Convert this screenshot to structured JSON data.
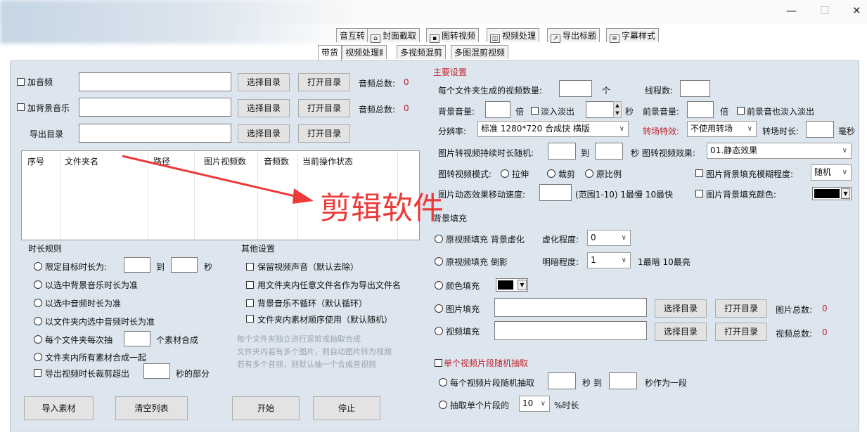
{
  "window": {
    "minimize": "—",
    "maximize": "☐",
    "close": "✕"
  },
  "tabs_row1": [
    {
      "label": "音互转",
      "icon": "audio-convert-icon"
    },
    {
      "label": "封面截取",
      "icon": "image-icon"
    },
    {
      "label": "图转视频",
      "icon": "picture-icon"
    },
    {
      "label": "视频处理",
      "icon": "film-icon"
    },
    {
      "label": "导出标题",
      "icon": "export-icon"
    },
    {
      "label": "字幕样式",
      "icon": "list-icon"
    }
  ],
  "tabs_row2": [
    {
      "label": "带货"
    },
    {
      "label": "视频处理Ⅱ"
    },
    {
      "label": "多视频混剪"
    },
    {
      "label": "多图混剪视频"
    }
  ],
  "left": {
    "add_audio": {
      "label": "加音频",
      "choose": "选择目录",
      "open": "打开目录",
      "count_label": "音频总数:",
      "count": "0"
    },
    "add_bgm": {
      "label": "加背景音乐",
      "choose": "选择目录",
      "open": "打开目录",
      "count_label": "音频总数:",
      "count": "0"
    },
    "export_dir": {
      "label": "导出目录",
      "choose": "选择目录",
      "open": "打开目录"
    },
    "table_headers": [
      "序号",
      "文件夹名",
      "路径",
      "图片视频数",
      "音频数",
      "当前操作状态"
    ],
    "duration_rules": {
      "title": "时长规则",
      "limit": "限定目标时长为:",
      "to": "到",
      "sec": "秒",
      "by_bgm": "以选中背景音乐时长为准",
      "by_audio": "以选中音频时长为准",
      "by_folder_audio": "以文件夹内选中音频时长为准",
      "per_folder": "每个文件夹每次抽",
      "per_folder_suffix": "个素材合成",
      "all_in_folder": "文件夹内所有素材合成一起",
      "trim_over": "导出视频时长裁剪超出",
      "trim_suffix": "秒的部分"
    },
    "other": {
      "title": "其他设置",
      "keep_sound": "保留视频声音（默认去除）",
      "use_filename": "用文件夹内任意文件名作为导出文件名",
      "bgm_noloop": "背景音乐不循环（默认循环）",
      "order_use": "文件夹内素材顺序使用（默认随机）",
      "note1": "每个文件夹独立进行混剪或抽取合成",
      "note2": "文件夹内若有多个图片，则自动图片转为视频",
      "note3": "若有多个音频，则默认抽一个合成音视频"
    },
    "buttons": {
      "import": "导入素材",
      "clear": "清空列表",
      "start": "开始",
      "stop": "停止"
    }
  },
  "right": {
    "section_title": "主要设置",
    "per_folder_count": "每个文件夹生成的视频数量:",
    "unit_ge": "个",
    "threads": "线程数:",
    "bg_volume": "背景音量:",
    "bei": "倍",
    "fade": "淡入淡出",
    "sec": "秒",
    "fg_volume": "前景音量:",
    "fg_fade": "前景音也淡入淡出",
    "resolution_label": "分辨率:",
    "resolution_value": "标准 1280*720 合成快 横版",
    "transition_label": "转场特效:",
    "transition_value": "不使用转场",
    "transition_dur": "转场时长:",
    "ms": "毫秒",
    "img_dur": "图片转视频持续时长随机:",
    "to": "到",
    "img_effect_label": "秒 图转视频效果:",
    "img_effect_value": "01.静态效果",
    "img_mode": "图转视频模式:",
    "stretch": "拉伸",
    "crop": "裁剪",
    "original": "原比例",
    "blur_fill": "图片背景填充模糊程度:",
    "blur_value": "随机",
    "move_speed": "图片动态效果移动速度:",
    "speed_hint": "(范围1-10) 1最慢 10最快",
    "bg_color": "图片背景填充颜色:",
    "bg_fill_title": "背景填充",
    "orig_fill": "原视频填充 背景虚化",
    "blur_degree": "虚化程度:",
    "blur_degree_value": "0",
    "orig_reflect": "原视频填充 倒影",
    "brightness": "明暗程度:",
    "brightness_value": "1",
    "brightness_hint": "1最暗 10最亮",
    "color_fill": "颜色填充",
    "image_fill": "图片填充",
    "video_fill": "视频填充",
    "choose": "选择目录",
    "open": "打开目录",
    "img_count_label": "图片总数:",
    "img_count": "0",
    "video_count_label": "视频总数:",
    "video_count": "0",
    "single_clip": "单个视频片段随机抽取",
    "each_clip": "每个视频片段随机抽取",
    "sec_to": "秒 到",
    "as_segment": "秒作为一段",
    "extract_single": "抽取单个片段的",
    "extract_value": "10",
    "percent_dur": "%时长"
  },
  "overlay_text": "剪辑软件",
  "colors": {
    "panel": "#dde6ef",
    "red_label": "#c0232c",
    "arrow": "#ec3a3a"
  }
}
